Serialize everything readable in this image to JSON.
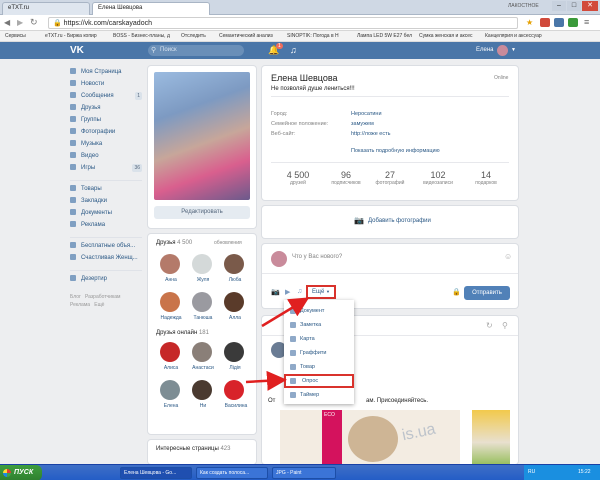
{
  "browser": {
    "tabs": [
      {
        "label": "eTXT.ru"
      },
      {
        "label": "Елена Шевцова"
      }
    ],
    "url": "https://vk.com/carskayadoch",
    "bookmarks": [
      "Сервисы",
      "eTXT.ru - Биржа копир",
      "BOSS - Бизнес-планы, д",
      "Отследить",
      "Семантический анализ",
      "SINOPTIK: Погода в Н",
      "Лампа LED 5W E27 бел",
      "Сумка женская и аксес",
      "Канцелярия и аксессуар"
    ],
    "window_buttons": {
      "min": "–",
      "max": "□",
      "close": "✕"
    },
    "corner_label": "ЛАКОСТНОЕ"
  },
  "vk": {
    "brand": "VK",
    "search_placeholder": "Поиск",
    "user_name": "Елена",
    "notify_count": "1",
    "icons": [
      "vk-logo-icon",
      "search-icon",
      "bell-icon",
      "music-icon",
      "avatar",
      "chevron-down-icon"
    ]
  },
  "sidebar": {
    "items": [
      {
        "label": "Моя Страница",
        "icon": "user-icon"
      },
      {
        "label": "Новости",
        "icon": "news-icon"
      },
      {
        "label": "Сообщения",
        "icon": "chat-icon",
        "badge": "1"
      },
      {
        "label": "Друзья",
        "icon": "friends-icon"
      },
      {
        "label": "Группы",
        "icon": "groups-icon"
      },
      {
        "label": "Фотографии",
        "icon": "camera-icon"
      },
      {
        "label": "Музыка",
        "icon": "music-icon"
      },
      {
        "label": "Видео",
        "icon": "video-icon"
      },
      {
        "label": "Игры",
        "icon": "game-icon",
        "badge": "36"
      }
    ],
    "items2": [
      {
        "label": "Товары",
        "icon": "shop-icon"
      },
      {
        "label": "Закладки",
        "icon": "bookmark-icon"
      },
      {
        "label": "Документы",
        "icon": "document-icon"
      },
      {
        "label": "Реклама",
        "icon": "ads-icon"
      }
    ],
    "items3": [
      {
        "label": "Бесплатные объя...",
        "icon": "app-icon"
      },
      {
        "label": "Счастливая Женщ...",
        "icon": "app-icon"
      }
    ],
    "items4": [
      {
        "label": "Дезертир",
        "icon": "game-icon"
      }
    ],
    "footer": [
      "Блог",
      "Разработчикам",
      "Реклама",
      "Ещё"
    ]
  },
  "profile": {
    "edit_button": "Редактировать",
    "name": "Елена Шевцова",
    "status": "Не позволяй душе лениться!!!",
    "online": "Online",
    "info": [
      {
        "k": "Город:",
        "v": "Неросатини"
      },
      {
        "k": "Семейное положение:",
        "v": "замужем"
      },
      {
        "k": "Веб-сайт:",
        "v": "http://ложе есть"
      }
    ],
    "show_more": "Показать подробную информацию",
    "counters": [
      {
        "n": "4 500",
        "l": "друзей"
      },
      {
        "n": "96",
        "l": "подписчиков"
      },
      {
        "n": "27",
        "l": "фотографий"
      },
      {
        "n": "102",
        "l": "видеозаписи"
      },
      {
        "n": "14",
        "l": "подарков"
      }
    ],
    "add_photos": "Добавить фотографии"
  },
  "friends": {
    "title": "Друзья",
    "count": "4 500",
    "updates": "обновления",
    "list": [
      "Анна",
      "Жуля",
      "Люба",
      "Надежда",
      "Танюша",
      "Алла"
    ],
    "online_title": "Друзья онлайн",
    "online_count": "181",
    "online_list": [
      "Алиса",
      "Анастаси",
      "Лідія",
      "Елена",
      "Ни",
      "Василина"
    ],
    "pages_title": "Интересные страницы",
    "pages_count": "423"
  },
  "composer": {
    "placeholder": "Что у Вас нового?",
    "more_label": "Ещё",
    "send": "Отправить"
  },
  "menu": {
    "items": [
      {
        "label": "Документ",
        "icon": "document-icon"
      },
      {
        "label": "Заметка",
        "icon": "note-icon"
      },
      {
        "label": "Карта",
        "icon": "map-icon"
      },
      {
        "label": "Граффити",
        "icon": "brush-icon"
      },
      {
        "label": "Товар",
        "icon": "shop-icon"
      },
      {
        "label": "Опрос",
        "icon": "poll-icon"
      },
      {
        "label": "Таймер",
        "icon": "timer-icon"
      }
    ]
  },
  "feed": {
    "post_partial": "От",
    "post_text": "ам. Присоединяйтесь.",
    "watermark": "is.ua",
    "eco": "ECO"
  },
  "taskbar": {
    "start": "ПУСК",
    "tasks": [
      "Елена Шевцова - Go...",
      "Как создать полоса...",
      "JPG - Paint"
    ],
    "lang": "RU",
    "clock": "15:22"
  }
}
